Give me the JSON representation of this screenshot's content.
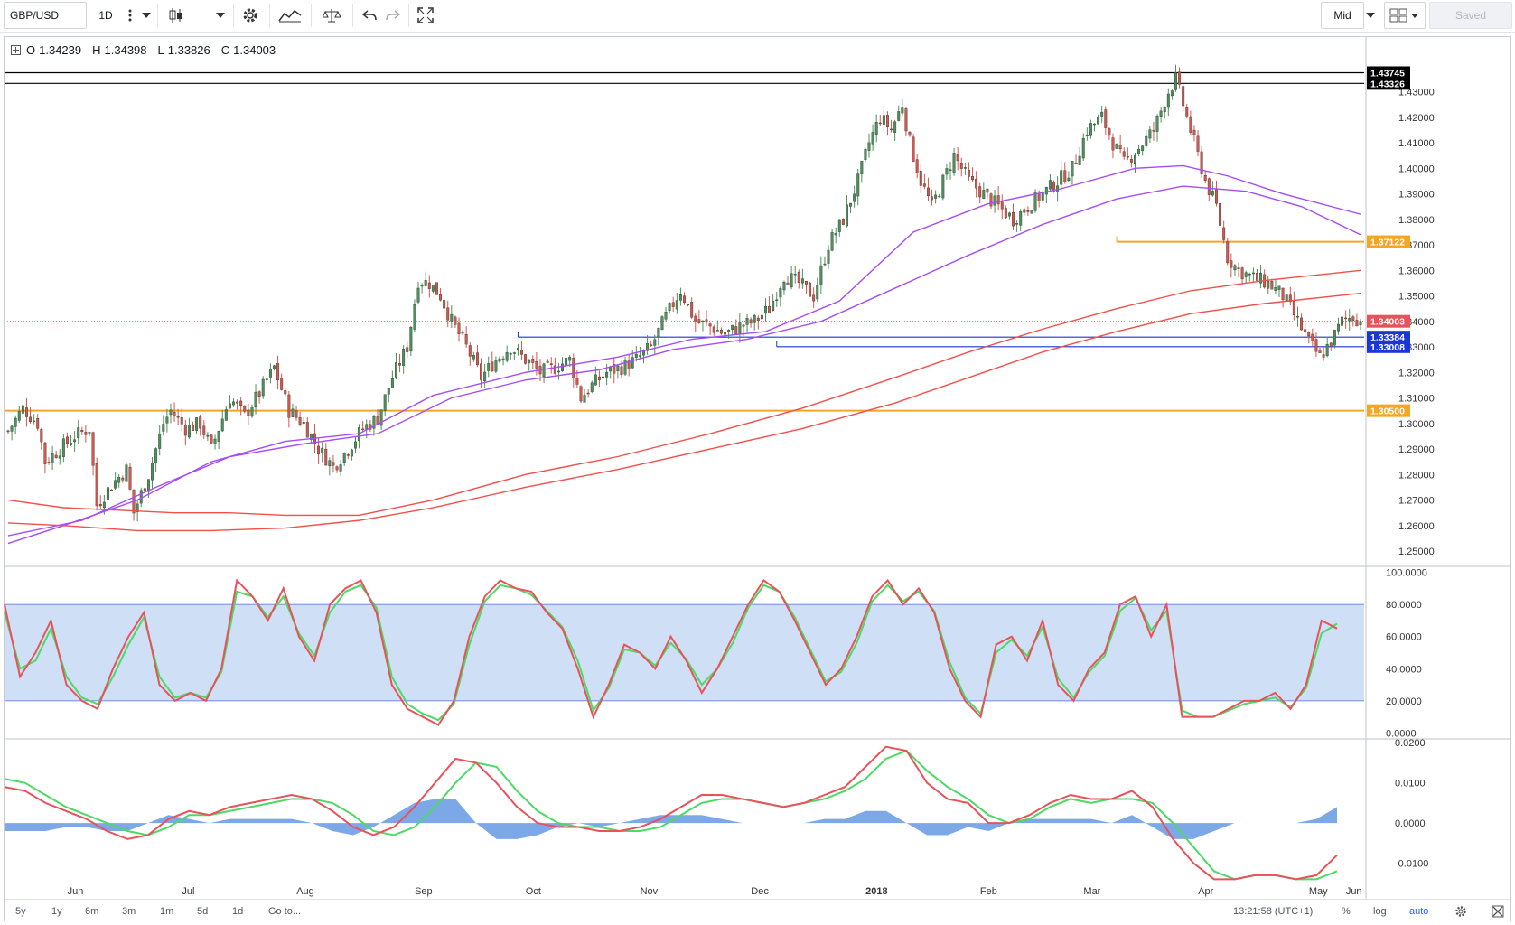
{
  "toolbar": {
    "symbol": "GBP/USD",
    "interval": "1D",
    "price_mode": "Mid",
    "saved_label": "Saved"
  },
  "legend": {
    "open_label": "O",
    "open": "1.34239",
    "high_label": "H",
    "high": "1.34398",
    "low_label": "L",
    "low": "1.33826",
    "close_label": "C",
    "close": "1.34003"
  },
  "bottom_bar": {
    "ranges": [
      "5y",
      "1y",
      "6m",
      "3m",
      "1m",
      "5d",
      "1d"
    ],
    "goto_label": "Go to...",
    "clock": "13:21:58 (UTC+1)",
    "percent_label": "%",
    "log_label": "log",
    "auto_label": "auto"
  },
  "colors": {
    "up_candle": "#4e8f5b",
    "down_candle": "#d9534f",
    "ma_fast": "#a64cf5",
    "ma_slow": "#f0504a",
    "support": "#f5a623",
    "blue_line": "#1a36d4",
    "stoch_k": "#e8525a",
    "stoch_d": "#4cd964",
    "band_fill": "#c9dcf5",
    "hist_fill": "#6f9fe6"
  },
  "chart_data": [
    {
      "type": "candlestick",
      "symbol": "GBP/USD",
      "interval": "1D",
      "x_tick_labels": [
        "Jun",
        "Jul",
        "Aug",
        "Sep",
        "Oct",
        "Nov",
        "Dec",
        "2018",
        "Feb",
        "Mar",
        "Apr",
        "May",
        "Jun"
      ],
      "y_tick_labels": [
        "1.43000",
        "1.42000",
        "1.41000",
        "1.40000",
        "1.39000",
        "1.38000",
        "1.37000",
        "1.36000",
        "1.35000",
        "1.34000",
        "1.33000",
        "1.32000",
        "1.31000",
        "1.30000",
        "1.29000",
        "1.28000",
        "1.27000",
        "1.26000",
        "1.25000"
      ],
      "ylim": [
        1.2447,
        1.4447
      ],
      "price_labels": [
        {
          "value": 1.43745,
          "text": "1.43745",
          "color": "#000000"
        },
        {
          "value": 1.43326,
          "text": "1.43326",
          "color": "#000000"
        },
        {
          "value": 1.37122,
          "text": "1.37122",
          "color": "#f5a623"
        },
        {
          "value": 1.34003,
          "text": "1.34003",
          "color": "#e8525a"
        },
        {
          "value": 1.33384,
          "text": "1.33384",
          "color": "#1a36d4"
        },
        {
          "value": 1.33008,
          "text": "1.33008",
          "color": "#1a36d4"
        },
        {
          "value": 1.305,
          "text": "1.30500",
          "color": "#f5a623"
        }
      ],
      "anchors": [
        [
          0,
          1.297
        ],
        [
          4,
          1.306
        ],
        [
          8,
          1.3
        ],
        [
          10,
          1.285
        ],
        [
          14,
          1.29
        ],
        [
          18,
          1.295
        ],
        [
          22,
          1.298
        ],
        [
          24,
          1.268
        ],
        [
          28,
          1.276
        ],
        [
          32,
          1.282
        ],
        [
          34,
          1.265
        ],
        [
          38,
          1.28
        ],
        [
          42,
          1.3
        ],
        [
          44,
          1.305
        ],
        [
          48,
          1.298
        ],
        [
          52,
          1.3
        ],
        [
          55,
          1.29
        ],
        [
          60,
          1.31
        ],
        [
          64,
          1.303
        ],
        [
          68,
          1.312
        ],
        [
          72,
          1.322
        ],
        [
          76,
          1.305
        ],
        [
          80,
          1.3
        ],
        [
          84,
          1.29
        ],
        [
          88,
          1.283
        ],
        [
          92,
          1.29
        ],
        [
          96,
          1.298
        ],
        [
          100,
          1.302
        ],
        [
          104,
          1.318
        ],
        [
          108,
          1.33
        ],
        [
          111,
          1.356
        ],
        [
          114,
          1.355
        ],
        [
          117,
          1.35
        ],
        [
          120,
          1.34
        ],
        [
          124,
          1.33
        ],
        [
          128,
          1.318
        ],
        [
          132,
          1.325
        ],
        [
          136,
          1.33
        ],
        [
          140,
          1.325
        ],
        [
          144,
          1.32
        ],
        [
          148,
          1.322
        ],
        [
          152,
          1.325
        ],
        [
          155,
          1.31
        ],
        [
          158,
          1.315
        ],
        [
          162,
          1.32
        ],
        [
          166,
          1.322
        ],
        [
          170,
          1.325
        ],
        [
          174,
          1.33
        ],
        [
          178,
          1.342
        ],
        [
          182,
          1.352
        ],
        [
          186,
          1.34
        ],
        [
          190,
          1.338
        ],
        [
          194,
          1.335
        ],
        [
          198,
          1.338
        ],
        [
          202,
          1.34
        ],
        [
          206,
          1.345
        ],
        [
          210,
          1.358
        ],
        [
          214,
          1.355
        ],
        [
          218,
          1.35
        ],
        [
          222,
          1.37
        ],
        [
          226,
          1.38
        ],
        [
          230,
          1.395
        ],
        [
          233,
          1.41
        ],
        [
          236,
          1.42
        ],
        [
          239,
          1.415
        ],
        [
          242,
          1.425
        ],
        [
          244,
          1.41
        ],
        [
          247,
          1.395
        ],
        [
          250,
          1.385
        ],
        [
          253,
          1.395
        ],
        [
          256,
          1.405
        ],
        [
          260,
          1.395
        ],
        [
          264,
          1.39
        ],
        [
          268,
          1.385
        ],
        [
          272,
          1.38
        ],
        [
          276,
          1.385
        ],
        [
          280,
          1.39
        ],
        [
          284,
          1.395
        ],
        [
          288,
          1.4
        ],
        [
          292,
          1.415
        ],
        [
          296,
          1.42
        ],
        [
          299,
          1.41
        ],
        [
          302,
          1.402
        ],
        [
          306,
          1.408
        ],
        [
          310,
          1.415
        ],
        [
          314,
          1.43
        ],
        [
          316,
          1.435
        ],
        [
          318,
          1.425
        ],
        [
          321,
          1.41
        ],
        [
          324,
          1.395
        ],
        [
          327,
          1.385
        ],
        [
          330,
          1.365
        ],
        [
          333,
          1.36
        ],
        [
          337,
          1.357
        ],
        [
          341,
          1.355
        ],
        [
          345,
          1.35
        ],
        [
          349,
          1.34
        ],
        [
          352,
          1.332
        ],
        [
          355,
          1.326
        ],
        [
          358,
          1.332
        ],
        [
          361,
          1.34
        ],
        [
          364,
          1.342
        ],
        [
          366,
          1.34
        ]
      ],
      "overlays": [
        {
          "color": "#a64cf5",
          "points": [
            [
              0,
              1.253
            ],
            [
              15,
              1.26
            ],
            [
              35,
              1.27
            ],
            [
              55,
              1.285
            ],
            [
              75,
              1.293
            ],
            [
              95,
              1.296
            ],
            [
              115,
              1.311
            ],
            [
              140,
              1.32
            ],
            [
              165,
              1.326
            ],
            [
              185,
              1.333
            ],
            [
              205,
              1.336
            ],
            [
              225,
              1.348
            ],
            [
              245,
              1.375
            ],
            [
              265,
              1.386
            ],
            [
              285,
              1.392
            ],
            [
              305,
              1.4
            ],
            [
              318,
              1.401
            ],
            [
              330,
              1.397
            ],
            [
              345,
              1.39
            ],
            [
              366,
              1.382
            ]
          ]
        },
        {
          "color": "#a64cf5",
          "points": [
            [
              0,
              1.256
            ],
            [
              20,
              1.262
            ],
            [
              40,
              1.275
            ],
            [
              60,
              1.287
            ],
            [
              80,
              1.292
            ],
            [
              100,
              1.296
            ],
            [
              120,
              1.31
            ],
            [
              140,
              1.317
            ],
            [
              160,
              1.321
            ],
            [
              180,
              1.329
            ],
            [
              200,
              1.333
            ],
            [
              220,
              1.34
            ],
            [
              240,
              1.353
            ],
            [
              260,
              1.366
            ],
            [
              280,
              1.378
            ],
            [
              300,
              1.388
            ],
            [
              318,
              1.393
            ],
            [
              335,
              1.391
            ],
            [
              350,
              1.385
            ],
            [
              366,
              1.374
            ]
          ]
        },
        {
          "color": "#f0504a",
          "points": [
            [
              0,
              1.27
            ],
            [
              15,
              1.267
            ],
            [
              30,
              1.266
            ],
            [
              45,
              1.265
            ],
            [
              60,
              1.265
            ],
            [
              75,
              1.264
            ],
            [
              95,
              1.264
            ],
            [
              115,
              1.27
            ],
            [
              140,
              1.28
            ],
            [
              165,
              1.287
            ],
            [
              190,
              1.296
            ],
            [
              215,
              1.306
            ],
            [
              240,
              1.318
            ],
            [
              260,
              1.328
            ],
            [
              280,
              1.337
            ],
            [
              300,
              1.345
            ],
            [
              320,
              1.352
            ],
            [
              340,
              1.356
            ],
            [
              366,
              1.36
            ]
          ]
        },
        {
          "color": "#f0504a",
          "points": [
            [
              0,
              1.261
            ],
            [
              15,
              1.26
            ],
            [
              35,
              1.258
            ],
            [
              55,
              1.258
            ],
            [
              75,
              1.259
            ],
            [
              95,
              1.262
            ],
            [
              115,
              1.267
            ],
            [
              140,
              1.275
            ],
            [
              165,
              1.282
            ],
            [
              190,
              1.29
            ],
            [
              215,
              1.298
            ],
            [
              240,
              1.308
            ],
            [
              260,
              1.318
            ],
            [
              280,
              1.328
            ],
            [
              300,
              1.336
            ],
            [
              320,
              1.343
            ],
            [
              340,
              1.347
            ],
            [
              366,
              1.351
            ]
          ]
        }
      ],
      "horizontal_lines": [
        {
          "value": 1.43745,
          "color": "#000000"
        },
        {
          "value": 1.43326,
          "color": "#000000"
        },
        {
          "value": 1.37122,
          "color": "#f5a623",
          "from": 300
        },
        {
          "value": 1.305,
          "color": "#f5a623"
        },
        {
          "value": 1.33384,
          "color": "#1a36d4",
          "from": 138
        },
        {
          "value": 1.33008,
          "color": "#1a36d4",
          "from": 208
        }
      ]
    },
    {
      "type": "line",
      "name": "stochastic",
      "y_tick_labels": [
        "100.0000",
        "80.0000",
        "60.0000",
        "40.0000",
        "20.0000",
        "0.0000"
      ],
      "ylim": [
        -2,
        102
      ],
      "band": [
        20,
        80
      ],
      "k": [
        80,
        35,
        50,
        70,
        30,
        20,
        15,
        40,
        60,
        75,
        30,
        20,
        25,
        20,
        40,
        95,
        85,
        70,
        90,
        60,
        45,
        80,
        90,
        95,
        75,
        30,
        15,
        10,
        5,
        20,
        60,
        85,
        95,
        90,
        88,
        75,
        65,
        40,
        10,
        30,
        55,
        50,
        40,
        60,
        45,
        25,
        40,
        60,
        80,
        95,
        88,
        70,
        50,
        30,
        40,
        60,
        85,
        95,
        80,
        90,
        75,
        40,
        20,
        10,
        55,
        60,
        45,
        70,
        30,
        20,
        40,
        50,
        80,
        85,
        60,
        80,
        10,
        10,
        10,
        15,
        20,
        20,
        25,
        15,
        30,
        70,
        65
      ],
      "d": [
        75,
        40,
        45,
        65,
        35,
        22,
        18,
        35,
        55,
        72,
        35,
        22,
        25,
        22,
        38,
        88,
        85,
        72,
        85,
        62,
        48,
        75,
        88,
        92,
        78,
        35,
        18,
        12,
        8,
        18,
        55,
        82,
        92,
        90,
        86,
        76,
        66,
        45,
        14,
        28,
        52,
        50,
        42,
        56,
        46,
        30,
        40,
        56,
        78,
        92,
        88,
        72,
        52,
        32,
        38,
        56,
        82,
        92,
        82,
        88,
        76,
        44,
        22,
        12,
        50,
        58,
        48,
        66,
        34,
        22,
        38,
        48,
        76,
        84,
        64,
        76,
        14,
        10,
        10,
        14,
        18,
        20,
        22,
        16,
        28,
        62,
        68
      ]
    },
    {
      "type": "line",
      "name": "macd",
      "y_tick_labels": [
        "0.0200",
        "0.0100",
        "0.0000",
        "-0.0100"
      ],
      "ylim": [
        -0.0155,
        0.0205
      ],
      "macd": [
        0.009,
        0.008,
        0.005,
        0.003,
        0.001,
        -0.002,
        -0.004,
        -0.003,
        0.001,
        0.003,
        0.002,
        0.004,
        0.005,
        0.006,
        0.007,
        0.006,
        0.003,
        -0.001,
        -0.003,
        -0.001,
        0.004,
        0.01,
        0.016,
        0.015,
        0.01,
        0.004,
        0.0,
        -0.001,
        -0.001,
        -0.002,
        -0.002,
        -0.001,
        0.001,
        0.004,
        0.007,
        0.007,
        0.006,
        0.005,
        0.004,
        0.005,
        0.007,
        0.009,
        0.014,
        0.019,
        0.018,
        0.01,
        0.006,
        0.005,
        0.0,
        0.0,
        0.002,
        0.005,
        0.007,
        0.006,
        0.006,
        0.008,
        0.004,
        -0.004,
        -0.01,
        -0.014,
        -0.014,
        -0.013,
        -0.013,
        -0.014,
        -0.013,
        -0.008
      ],
      "signal": [
        0.011,
        0.01,
        0.007,
        0.004,
        0.002,
        0.0,
        -0.002,
        -0.003,
        -0.001,
        0.002,
        0.002,
        0.003,
        0.004,
        0.005,
        0.006,
        0.006,
        0.005,
        0.002,
        -0.002,
        -0.003,
        -0.001,
        0.004,
        0.01,
        0.015,
        0.014,
        0.008,
        0.003,
        0.0,
        -0.001,
        -0.001,
        -0.002,
        -0.002,
        -0.001,
        0.002,
        0.005,
        0.006,
        0.006,
        0.005,
        0.004,
        0.005,
        0.006,
        0.008,
        0.011,
        0.016,
        0.018,
        0.013,
        0.009,
        0.006,
        0.002,
        0.0,
        0.001,
        0.004,
        0.006,
        0.005,
        0.006,
        0.006,
        0.005,
        0.0,
        -0.006,
        -0.012,
        -0.014,
        -0.013,
        -0.013,
        -0.014,
        -0.014,
        -0.012
      ],
      "histogram": [
        -0.002,
        -0.002,
        -0.002,
        -0.001,
        -0.001,
        -0.002,
        -0.002,
        0.0,
        0.002,
        0.001,
        0.0,
        0.001,
        0.001,
        0.001,
        0.001,
        0.0,
        -0.002,
        -0.003,
        -0.001,
        0.002,
        0.005,
        0.006,
        0.006,
        0.0,
        -0.004,
        -0.004,
        -0.003,
        -0.001,
        0.0,
        -0.001,
        0.0,
        0.001,
        0.002,
        0.002,
        0.002,
        0.001,
        0.0,
        0.0,
        0.0,
        0.0,
        0.001,
        0.001,
        0.003,
        0.003,
        0.0,
        -0.003,
        -0.003,
        -0.001,
        -0.002,
        0.0,
        0.001,
        0.001,
        0.001,
        0.001,
        0.0,
        0.002,
        -0.001,
        -0.004,
        -0.004,
        -0.002,
        0.0,
        0.0,
        0.0,
        0.0,
        0.001,
        0.004
      ]
    }
  ]
}
